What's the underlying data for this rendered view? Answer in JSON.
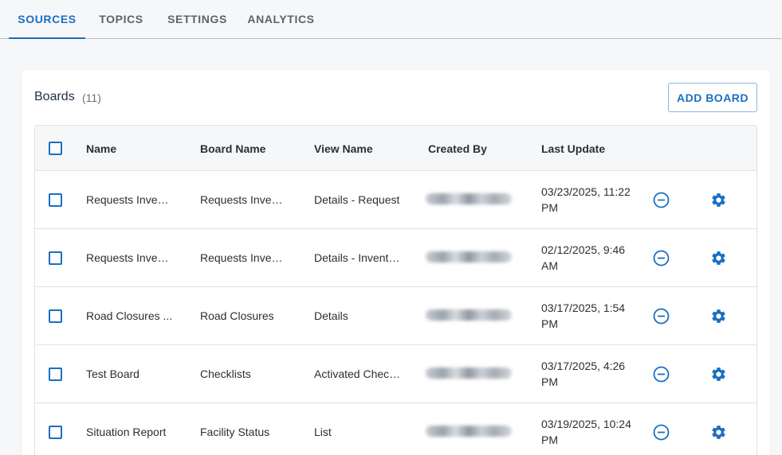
{
  "tabs": [
    {
      "label": "SOURCES",
      "active": true
    },
    {
      "label": "TOPICS",
      "active": false
    },
    {
      "label": "SETTINGS",
      "active": false
    },
    {
      "label": "ANALYTICS",
      "active": false
    }
  ],
  "card": {
    "title": "Boards",
    "count": "(11)",
    "add_button": "ADD BOARD"
  },
  "table": {
    "columns": [
      "Name",
      "Board Name",
      "View Name",
      "Created By",
      "Last Update"
    ],
    "rows": [
      {
        "name": "Requests Inventory",
        "board": "Requests Inventory",
        "view": "Details - Request",
        "updated": "03/23/2025, 11:22 PM"
      },
      {
        "name": "Requests Inventory",
        "board": "Requests Inventory",
        "view": "Details - Inventory",
        "updated": "02/12/2025, 9:46 AM"
      },
      {
        "name": "Road Closures ...",
        "board": "Road Closures",
        "view": "Details",
        "updated": "03/17/2025, 1:54 PM"
      },
      {
        "name": "Test Board",
        "board": "Checklists",
        "view": "Activated Checklists",
        "updated": "03/17/2025, 4:26 PM"
      },
      {
        "name": "Situation Report",
        "board": "Facility Status",
        "view": "List",
        "updated": "03/19/2025, 10:24 PM"
      }
    ]
  },
  "icons": {
    "remove": "minus-circle-icon",
    "settings": "gear-icon"
  },
  "colors": {
    "accent": "#1a6fc0"
  }
}
